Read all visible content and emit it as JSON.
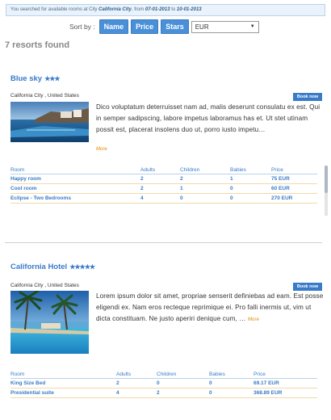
{
  "search_summary": {
    "prefix": "You searched for available rooms at City ",
    "city": "California City",
    "from_text": ", from ",
    "from_date": "07-01-2013",
    "to_text": " to ",
    "to_date": "10-01-2013"
  },
  "sort": {
    "label": "Sort by :",
    "buttons": [
      "Name",
      "Price",
      "Stars"
    ],
    "currency": "EUR"
  },
  "results_count": "7 resorts found",
  "hotels": [
    {
      "name": "Blue sky",
      "stars": "★★★",
      "location": "California City , United States",
      "book_label": "Book now",
      "description": "Dico voluptatum deterruisset nam ad, malis deserunt consulatu ex est. Qui in semper sadipscing, labore impetus laboramus has et. Ut stet utinam possit est, placerat insolens duo ut, porro iusto impetu…",
      "more_label": "More",
      "columns": [
        "Room",
        "Adults",
        "Children",
        "Babies",
        "Price"
      ],
      "rooms": [
        {
          "room": "Happy room",
          "adults": "2",
          "children": "2",
          "babies": "1",
          "price": "75 EUR"
        },
        {
          "room": "Cool room",
          "adults": "2",
          "children": "1",
          "babies": "0",
          "price": "60 EUR"
        },
        {
          "room": "Eclipse - Two Bedrooms",
          "adults": "4",
          "children": "0",
          "babies": "0",
          "price": "270 EUR"
        }
      ]
    },
    {
      "name": "California Hotel",
      "stars": "★★★★★",
      "location": "California City , United States",
      "book_label": "Book now",
      "description": "Lorem ipsum dolor sit amet, propriae senserit definiebas ad eam. Est posse eligendi ex. Nam eros recteque reprimique ei. Pro falli inermis ut, vim ut dicta constituam. Ne justo aperiri denique cum, …",
      "more_label": "More",
      "columns": [
        "Room",
        "Adults",
        "Children",
        "Babies",
        "Price"
      ],
      "rooms": [
        {
          "room": "King Size Bed",
          "adults": "2",
          "children": "0",
          "babies": "0",
          "price": "69.17 EUR"
        },
        {
          "room": "Presidential suite",
          "adults": "4",
          "children": "2",
          "babies": "0",
          "price": "368.89 EUR"
        }
      ]
    }
  ],
  "colors": {
    "accent": "#3a7bc8",
    "button": "#4a90d9",
    "more": "#e08a00"
  }
}
